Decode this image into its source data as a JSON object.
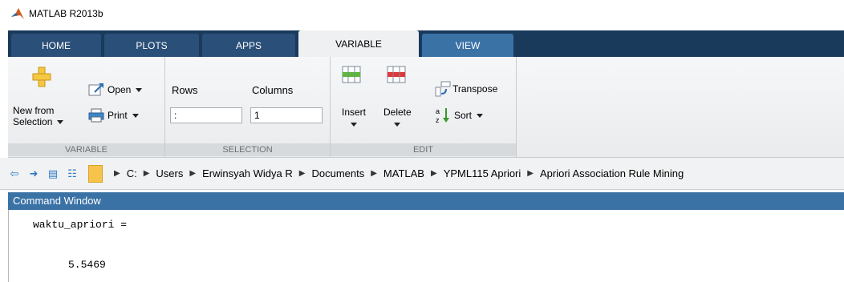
{
  "window": {
    "title": "MATLAB R2013b"
  },
  "tabs": [
    {
      "label": "HOME"
    },
    {
      "label": "PLOTS"
    },
    {
      "label": "APPS"
    },
    {
      "label": "VARIABLE"
    },
    {
      "label": "VIEW"
    }
  ],
  "toolstrip": {
    "variable_group": {
      "label": "VARIABLE",
      "new_from_selection": "New from\nSelection",
      "new_from_line1": "New from",
      "new_from_line2": "Selection",
      "open": "Open",
      "print": "Print"
    },
    "selection_group": {
      "label": "SELECTION",
      "rows_label": "Rows",
      "columns_label": "Columns",
      "rows_value": ":",
      "columns_value": "1"
    },
    "edit_group": {
      "label": "EDIT",
      "insert": "Insert",
      "delete": "Delete",
      "transpose": "Transpose",
      "sort": "Sort"
    }
  },
  "path": {
    "crumbs": [
      "C:",
      "Users",
      "Erwinsyah Widya R",
      "Documents",
      "MATLAB",
      "YPML115 Apriori",
      "Apriori Association Rule Mining"
    ]
  },
  "command_window": {
    "title": "Command Window",
    "line1": "waktu_apriori =",
    "line2": "5.5469"
  },
  "colors": {
    "tab_strip": "#1a3a5c",
    "header_blue": "#3a72a6",
    "folder": "#f6c34b"
  }
}
